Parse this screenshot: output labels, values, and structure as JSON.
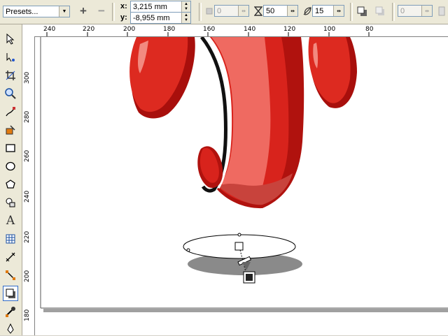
{
  "propbar": {
    "presets_label": "Presets...",
    "x_label": "x:",
    "x_value": "3,215 mm",
    "y_label": "y:",
    "y_value": "-8,955 mm",
    "angle_value": "0",
    "opacity_value": "50",
    "feather_value": "15",
    "stretch_value": "0"
  },
  "ruler": {
    "h_ticks": [
      "240",
      "220",
      "200",
      "180",
      "160",
      "140",
      "120",
      "100",
      "80"
    ],
    "v_ticks": [
      "300",
      "280",
      "260",
      "240",
      "220",
      "200",
      "180"
    ]
  },
  "icons": {
    "add": "plus-icon",
    "remove": "minus-icon",
    "angle": "angle-lock-icon",
    "opacity": "hourglass-opacity-icon",
    "feather": "feather-icon",
    "shadow_direction": "shadow-direction-icon",
    "copy_shadow": "copy-shadow-icon"
  },
  "colors": {
    "accent_red": "#d8231c",
    "dark_red": "#a80f0c",
    "light_red": "#ef6a61",
    "shadow_gray": "#8a8a8a"
  }
}
